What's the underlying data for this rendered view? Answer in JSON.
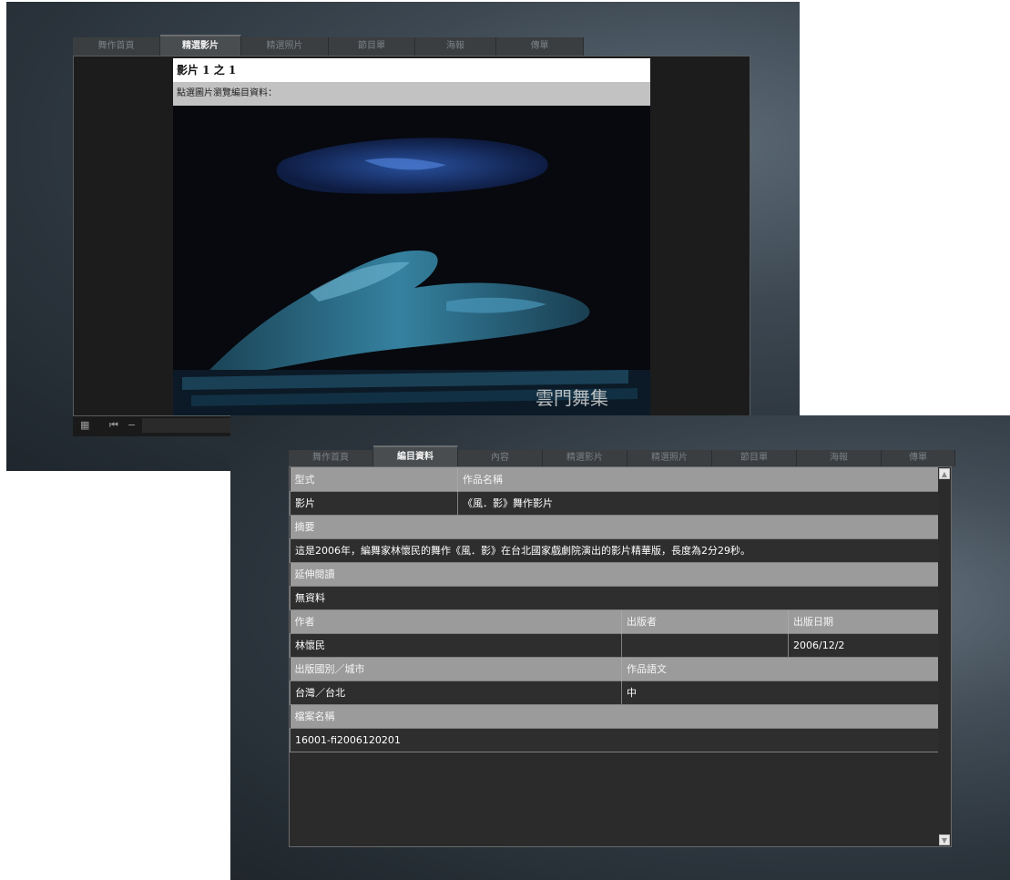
{
  "video_window": {
    "tabs": [
      "舞作首頁",
      "精選影片",
      "精選照片",
      "節目單",
      "海報",
      "傳單"
    ],
    "active_tab": 1,
    "title": "影片 1 之 1",
    "hint": "點選圖片瀏覽編目資料：",
    "watermark": "雲門舞集",
    "controls": {
      "grid_icon": "grid-icon",
      "skip_icon": "skip-back-icon",
      "minus": "−"
    }
  },
  "catalog_window": {
    "tabs": [
      "舞作首頁",
      "編目資料",
      "內容",
      "精選影片",
      "精選照片",
      "節目單",
      "海報",
      "傳單"
    ],
    "active_tab": 1,
    "fields": {
      "type_label": "型式",
      "title_label": "作品名稱",
      "type_value": "影片",
      "title_value": "《風．影》舞作影片",
      "abstract_label": "摘要",
      "abstract_value": "這是2006年，編舞家林懷民的舞作《風．影》在台北國家戲劇院演出的影片精華版，長度為2分29秒。",
      "reading_label": "延伸閱讀",
      "reading_value": "無資料",
      "author_label": "作者",
      "publisher_label": "出版者",
      "date_label": "出版日期",
      "author_value": "林懷民",
      "publisher_value": "",
      "date_value": "2006/12/2",
      "place_label": "出版國別／城市",
      "language_label": "作品語文",
      "place_value": "台灣／台北",
      "language_value": "中",
      "filename_label": "檔案名稱",
      "filename_value": "16001-fi2006120201"
    }
  }
}
